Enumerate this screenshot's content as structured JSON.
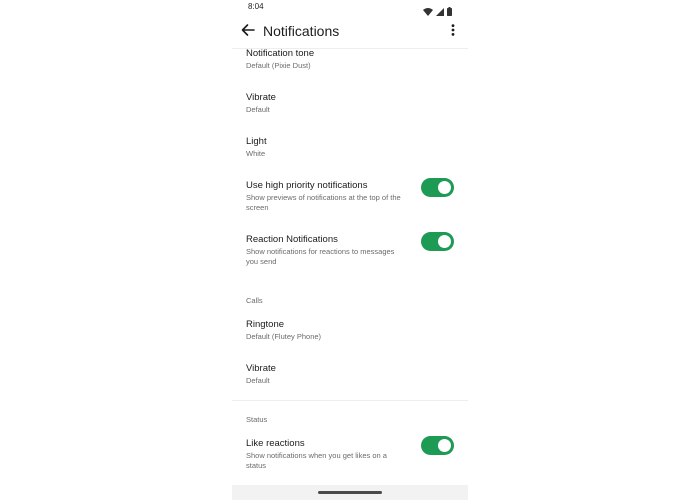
{
  "status_bar": {
    "time": "8:04",
    "icons": [
      "wifi-icon",
      "signal-icon",
      "battery-icon"
    ]
  },
  "app_bar": {
    "title": "Notifications",
    "back_icon": "arrow-left-icon",
    "menu_icon": "more-vert-icon"
  },
  "messages": [
    {
      "title": "Notification tone",
      "subtitle": "Default (Pixie Dust)"
    },
    {
      "title": "Vibrate",
      "subtitle": "Default"
    },
    {
      "title": "Light",
      "subtitle": "White"
    },
    {
      "title": "Use high priority notifications",
      "subtitle": "Show previews of notifications at the top of the screen",
      "toggle": true
    },
    {
      "title": "Reaction Notifications",
      "subtitle": "Show notifications for reactions to messages you send",
      "toggle": true
    }
  ],
  "calls": {
    "header": "Calls",
    "items": [
      {
        "title": "Ringtone",
        "subtitle": "Default (Flutey Phone)"
      },
      {
        "title": "Vibrate",
        "subtitle": "Default"
      }
    ]
  },
  "status": {
    "header": "Status",
    "items": [
      {
        "title": "Like reactions",
        "subtitle": "Show notifications when you get likes on a status",
        "toggle": true
      }
    ]
  },
  "colors": {
    "toggle_on": "#1d9a54",
    "primary_text": "#1c1c1c",
    "secondary_text": "#6b6b6b"
  }
}
